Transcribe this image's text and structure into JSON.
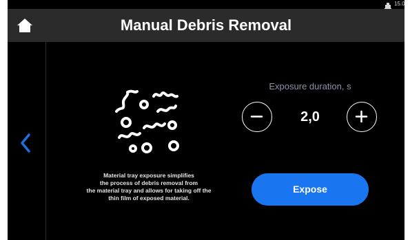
{
  "status_bar": {
    "icon": "printer-status-icon",
    "value": "15.0"
  },
  "header": {
    "home_icon": "home-icon",
    "title": "Manual Debris Removal"
  },
  "navigation": {
    "back_icon": "chevron-left-icon"
  },
  "illustration": {
    "icon": "debris-particles-icon"
  },
  "description": {
    "lines": [
      "Material tray exposure simplifies",
      "the process of debris removal from",
      "the material tray and allows for taking off the",
      "thin film of exposed material."
    ]
  },
  "exposure": {
    "label": "Exposure duration, s",
    "value": "2,0",
    "decrement_icon": "minus-icon",
    "increment_icon": "plus-icon"
  },
  "actions": {
    "expose_label": "Expose"
  },
  "colors": {
    "background": "#000000",
    "header": "#2b2b2b",
    "accent": "#1976f0",
    "label": "#8b91a8",
    "text": "#ffffff"
  }
}
